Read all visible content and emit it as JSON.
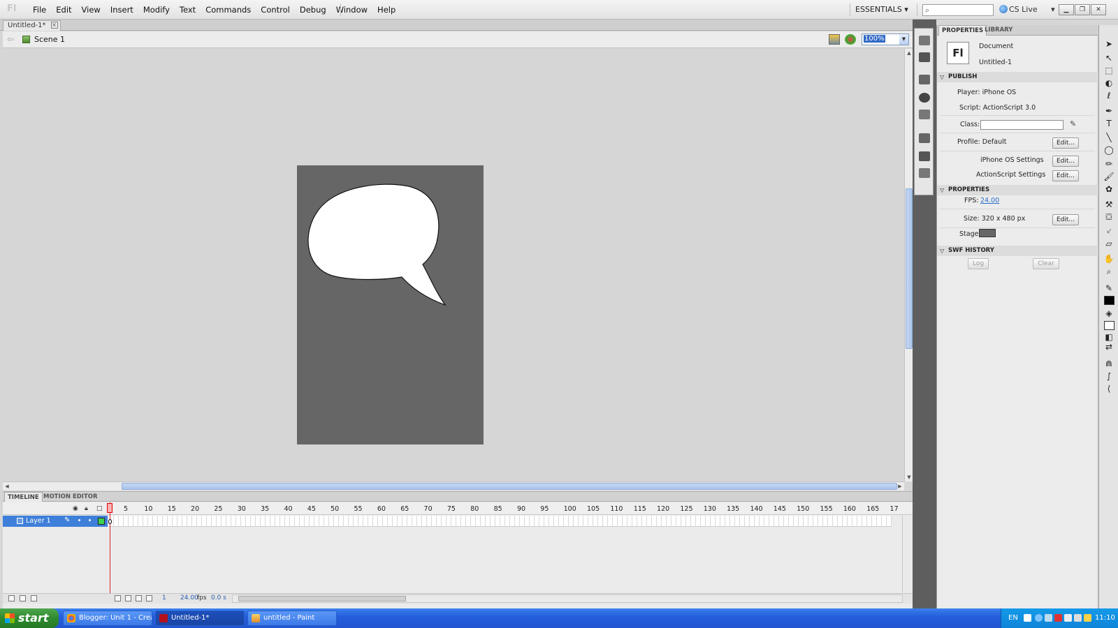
{
  "app": {
    "logo": "Fl"
  },
  "menu": [
    "File",
    "Edit",
    "View",
    "Insert",
    "Modify",
    "Text",
    "Commands",
    "Control",
    "Debug",
    "Window",
    "Help"
  ],
  "header": {
    "workspace": "ESSENTIALS",
    "cs_live": "CS Live",
    "search_value": ""
  },
  "document": {
    "tab_title": "Untitled-1*",
    "scene_label": "Scene 1",
    "zoom": "100%"
  },
  "stage": {
    "background_color": "#666666",
    "bubble_color": "#ffffff"
  },
  "timeline": {
    "tab_timeline": "TIMELINE",
    "tab_motion": "MOTION EDITOR",
    "ruler": [
      "5",
      "10",
      "15",
      "20",
      "25",
      "30",
      "35",
      "40",
      "45",
      "50",
      "55",
      "60",
      "65",
      "70",
      "75",
      "80",
      "85",
      "90",
      "95",
      "100",
      "105",
      "110",
      "115",
      "120",
      "125",
      "130",
      "135",
      "140",
      "145",
      "150",
      "155",
      "160",
      "165",
      "17"
    ],
    "layer_name": "Layer 1",
    "current_frame": "1",
    "fps": "24.00",
    "fps_unit": "fps",
    "elapsed": "0.0 s"
  },
  "properties": {
    "tab_properties": "PROPERTIES",
    "tab_library": "LIBRARY",
    "doc_icon": "Fl",
    "doc_type": "Document",
    "doc_name": "Untitled-1",
    "publish": {
      "header": "PUBLISH",
      "player": "Player: iPhone OS",
      "script": "Script: ActionScript 3.0",
      "class_label": "Class:",
      "class_value": "",
      "profile": "Profile: Default",
      "iphone_settings": "iPhone OS Settings",
      "as_settings": "ActionScript Settings",
      "edit": "Edit..."
    },
    "props": {
      "header": "PROPERTIES",
      "fps_label": "FPS:",
      "fps_value": "24.00",
      "size": "Size: 320 x 480 px",
      "stage_label": "Stage:",
      "stage_color": "#666666"
    },
    "swf": {
      "header": "SWF HISTORY",
      "log": "Log",
      "clear": "Clear"
    }
  },
  "taskbar": {
    "start": "start",
    "tasks": [
      {
        "label": "Blogger: Unit 1 - Crea...",
        "icon": "chrome-icon"
      },
      {
        "label": "Untitled-1*",
        "icon": "flash-icon"
      },
      {
        "label": "untitled - Paint",
        "icon": "paint-icon"
      }
    ],
    "lang": "EN",
    "clock": "11:10"
  }
}
